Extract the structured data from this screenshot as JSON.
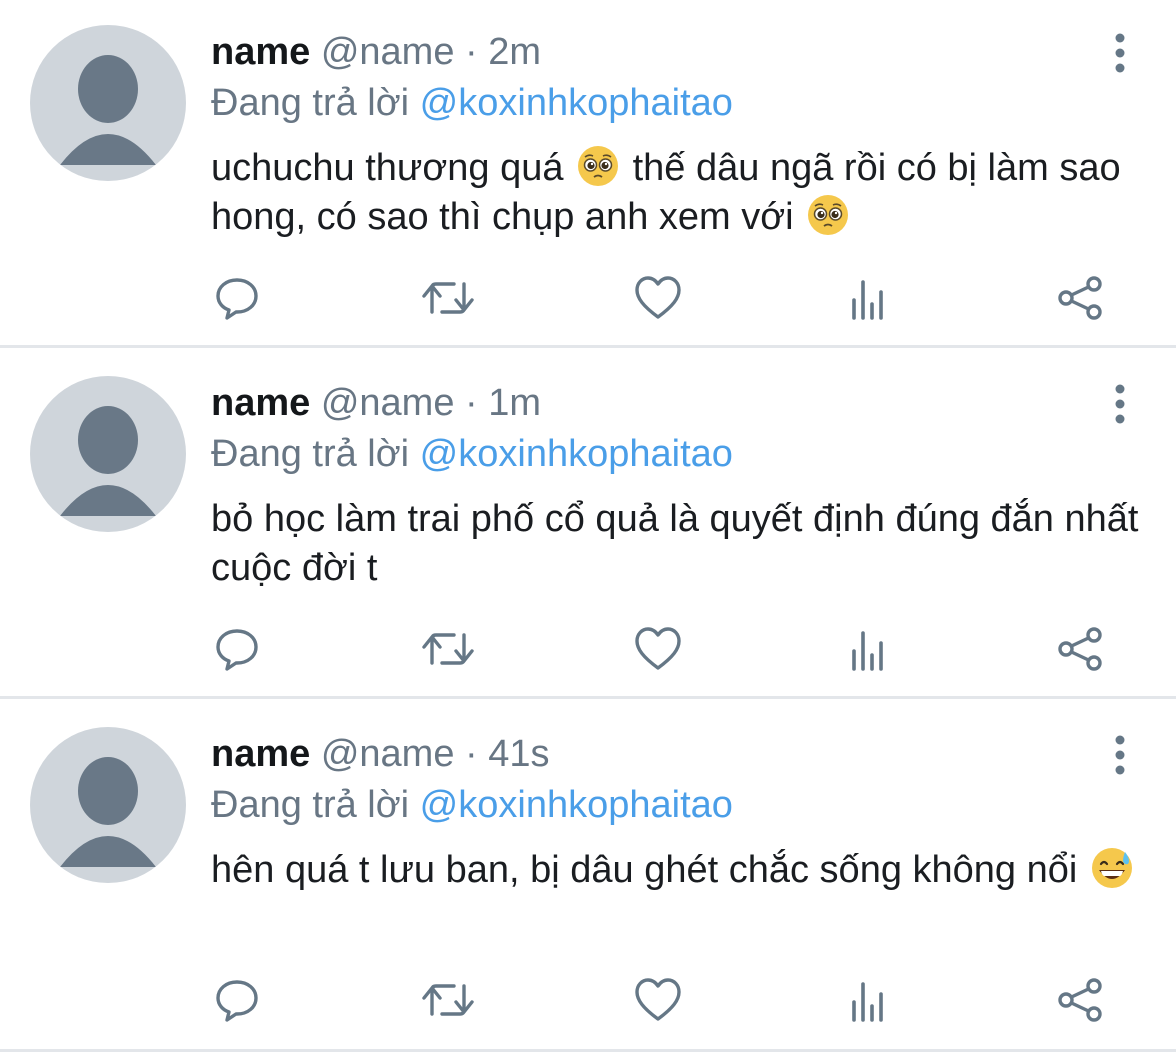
{
  "tweets": [
    {
      "display_name": "name",
      "handle": "@name",
      "separator": "·",
      "time": "2m",
      "reply_prefix": "Đang trả lời",
      "reply_to": "@koxinhkophaitao",
      "text_parts": [
        "uchuchu thương quá ",
        " thế dâu ngã rồi có bị làm sao hong, có sao thì chụp anh xem với "
      ],
      "emoji": "pleading-face-emoji"
    },
    {
      "display_name": "name",
      "handle": "@name",
      "separator": "·",
      "time": "1m",
      "reply_prefix": "Đang trả lời",
      "reply_to": "@koxinhkophaitao",
      "text_parts": [
        "bỏ học làm trai phố cổ quả là quyết định đúng đắn nhất cuộc đời t"
      ]
    },
    {
      "display_name": "name",
      "handle": "@name",
      "separator": "·",
      "time": "41s",
      "reply_prefix": "Đang trả lời",
      "reply_to": "@koxinhkophaitao",
      "text_parts": [
        "hên quá t lưu ban, bị dâu ghét chắc sống không nổi "
      ],
      "emoji": "grinning-sweat-emoji"
    }
  ],
  "icons": {
    "more": "more-vertical-icon",
    "reply": "reply-bubble-icon",
    "retweet": "retweet-icon",
    "like": "heart-icon",
    "views": "views-bar-chart-icon",
    "share": "share-icon"
  },
  "colors": {
    "mention": "#4a9ee8",
    "muted": "#687684",
    "icon": "#657786",
    "avatar_bg": "#cfd5db",
    "avatar_fg": "#697887",
    "divider": "#e3e6ea"
  }
}
